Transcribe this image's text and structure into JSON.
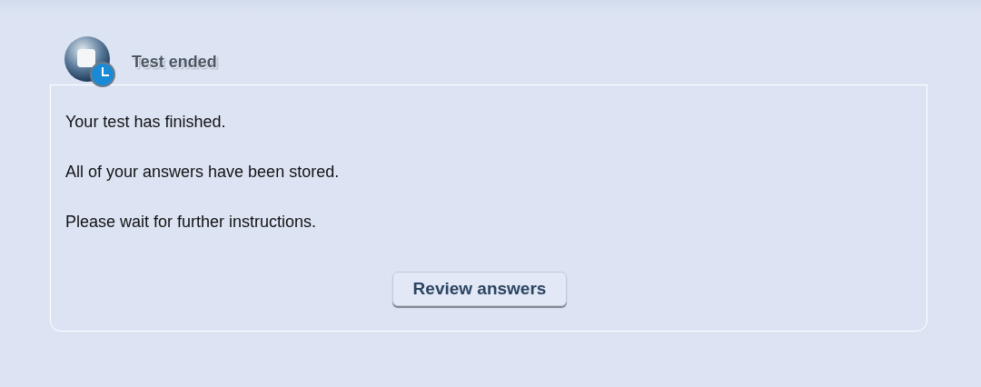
{
  "dialog": {
    "title": "Test ended",
    "messages": [
      "Your test has finished.",
      "All of your answers have been stored.",
      "Please wait for further instructions."
    ],
    "button": "Review answers"
  }
}
